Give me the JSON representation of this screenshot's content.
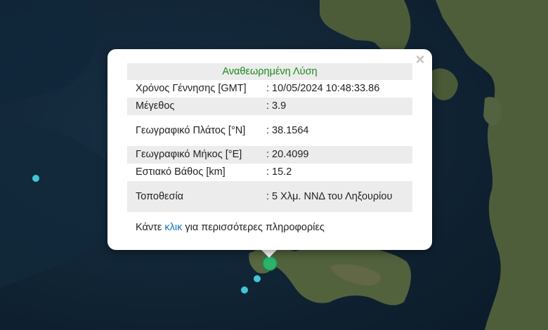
{
  "popup": {
    "title": "Αναθεωρημένη Λύση",
    "close_symbol": "×",
    "rows": [
      {
        "label": "Χρόνος Γέννησης [GMT]",
        "value": ": 10/05/2024 10:48:33.86"
      },
      {
        "label": "Μέγεθος",
        "value": ": 3.9"
      },
      {
        "label": "Γεωγραφικό Πλάτος [°N]",
        "value": ": 38.1564"
      },
      {
        "label": "Γεωγραφικό Μήκος [°E]",
        "value": ": 20.4099"
      },
      {
        "label": "Εστιακό Βάθος [km]",
        "value": ": 15.2"
      },
      {
        "label": "Τοποθεσία",
        "value": ": 5 Χλμ. ΝΝΔ του Ληξουρίου"
      }
    ],
    "more": {
      "prefix": "Κάντε ",
      "link": "κλικ",
      "suffix": " για περισσότερες πληροφορίες"
    }
  },
  "colors": {
    "sea": "#0f2233",
    "land": "#4a5a36",
    "title_green": "#1a8a1a",
    "link_blue": "#1177bb",
    "marker_main": "#2db36a",
    "marker_small": "#41c6d8"
  }
}
